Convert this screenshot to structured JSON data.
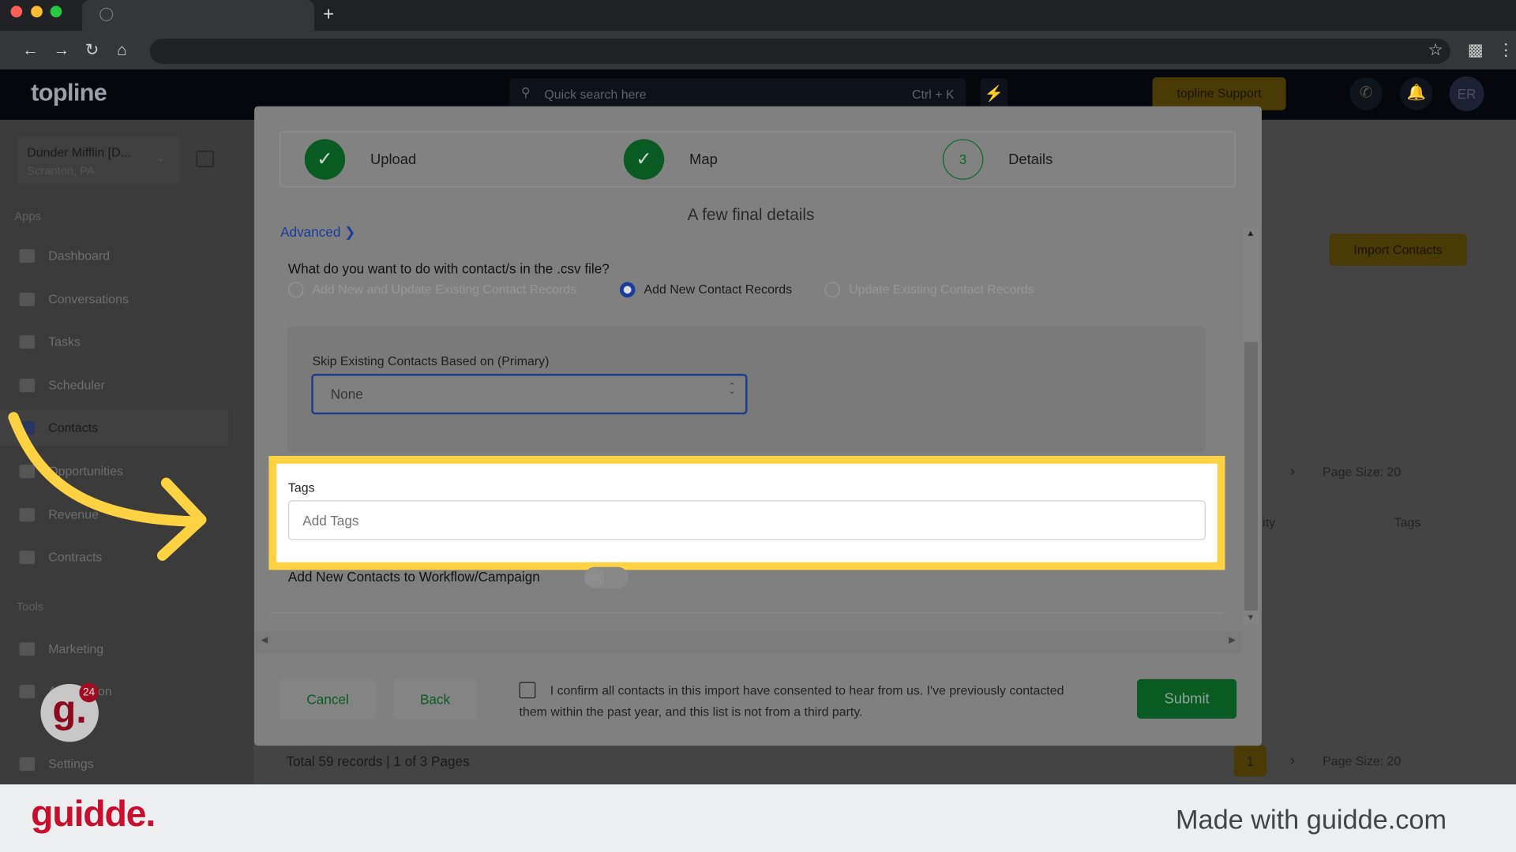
{
  "browser": {
    "new_tab": "+"
  },
  "app": {
    "logo": "topline",
    "search_placeholder": "Quick search here",
    "search_shortcut": "Ctrl + K",
    "support_label": "topline Support",
    "avatar": "ER"
  },
  "sidebar": {
    "account_name": "Dunder Mifflin [D...",
    "account_location": "Scranton, PA",
    "apps_heading": "Apps",
    "tools_heading": "Tools",
    "items": [
      {
        "label": "Dashboard"
      },
      {
        "label": "Conversations"
      },
      {
        "label": "Tasks"
      },
      {
        "label": "Scheduler"
      },
      {
        "label": "Contacts"
      },
      {
        "label": "Opportunities"
      },
      {
        "label": "Revenue"
      },
      {
        "label": "Contracts"
      }
    ],
    "tools": [
      {
        "label": "Marketing"
      },
      {
        "label": "Automation"
      },
      {
        "label": "Settings"
      }
    ],
    "badge": "24"
  },
  "background": {
    "import_button": "Import Contacts",
    "page_size": "Page Size: 20",
    "col_tags": "Tags",
    "col_city": "ity",
    "total": "Total 59 records",
    "pages": "1 of 3 Pages",
    "page_num": "1"
  },
  "modal": {
    "steps": [
      {
        "label": "Upload",
        "state": "done"
      },
      {
        "label": "Map",
        "state": "done"
      },
      {
        "label": "Details",
        "number": "3",
        "state": "current"
      }
    ],
    "title": "A few final details",
    "advanced": "Advanced",
    "question": "What do you want to do with contact/s in the .csv file?",
    "options": [
      {
        "label": "Add New and Update Existing Contact Records",
        "selected": false
      },
      {
        "label": "Add New Contact Records",
        "selected": true
      },
      {
        "label": "Update Existing Contact Records",
        "selected": false
      }
    ],
    "skip_label": "Skip Existing Contacts Based on (Primary)",
    "skip_value": "None",
    "tags_label": "Tags",
    "tags_placeholder": "Add Tags",
    "workflow_label": "Add New Contacts to Workflow/Campaign",
    "workflow_enabled": false,
    "consent_text": "I confirm all contacts in this import have consented to hear from us. I've previously contacted them within the past year, and this list is not from a third party.",
    "consent_checked": false,
    "cancel": "Cancel",
    "back": "Back",
    "submit": "Submit"
  },
  "colors": {
    "highlight": "#ffd244",
    "success": "#0a7a30",
    "brand_red": "#c8102e"
  },
  "footer": {
    "logo": "guidde.",
    "made_with": "Made with guidde.com"
  }
}
